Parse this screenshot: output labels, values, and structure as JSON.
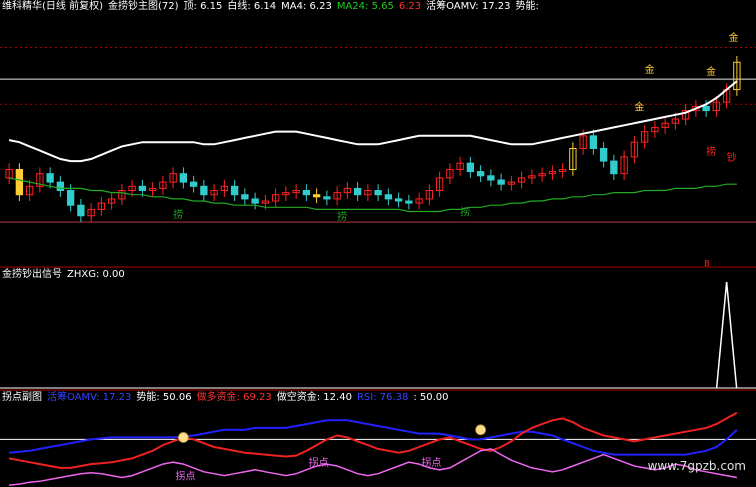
{
  "colors": {
    "bg": "#000000",
    "white_line": "#ffffff",
    "green_line": "#22aa22",
    "up": "#ff2222",
    "down": "#33cccc",
    "gold": "#ffcc33",
    "divider": "#aa0000",
    "blue": "#2222ff",
    "red": "#ee2222",
    "purple": "#ee66ee"
  },
  "main_header": {
    "stock_name": "维科精华(日线 前复权)",
    "indicator": "金捞钞主图(72)",
    "top_label": "顶: 6.15",
    "white_label": "白线: 6.14",
    "ma4_label": "MA4: 6.23",
    "ma24_label": "MA24: 5.65",
    "extra_value": "6.23",
    "oamv_label": "活筹OAMV: 17.23",
    "shineng_label": "势能:"
  },
  "signal_header": {
    "title": "金捞钞出信号",
    "value_label": "ZHXG: 0.00"
  },
  "sub_header": {
    "title": "拐点副图",
    "oamv": "活筹OAMV: 17.23",
    "shineng": "势能: 50.06",
    "duo": "做多资金: 69.23",
    "kong": "做空资金: 12.40",
    "rsi": "RSI: 76.38",
    "ref": ": 50.00"
  },
  "markers": {
    "jin": "金",
    "lao": "捞",
    "chao": "钞",
    "guaidian": "拐点",
    "bottom_tag": "B"
  },
  "watermark": "www.7gpzb.com",
  "chart_data": {
    "type": "line",
    "title": "",
    "n_bars": 72,
    "main_levels": {
      "top": 6.15,
      "ma4": 6.23,
      "ma24": 5.65,
      "white": 6.14
    },
    "white_line": [
      5.86,
      5.85,
      5.83,
      5.81,
      5.79,
      5.77,
      5.76,
      5.76,
      5.77,
      5.79,
      5.81,
      5.83,
      5.84,
      5.85,
      5.85,
      5.85,
      5.85,
      5.85,
      5.85,
      5.84,
      5.84,
      5.85,
      5.86,
      5.87,
      5.88,
      5.89,
      5.9,
      5.9,
      5.9,
      5.89,
      5.88,
      5.87,
      5.86,
      5.85,
      5.84,
      5.84,
      5.84,
      5.85,
      5.86,
      5.87,
      5.88,
      5.88,
      5.88,
      5.88,
      5.88,
      5.88,
      5.87,
      5.86,
      5.85,
      5.84,
      5.84,
      5.84,
      5.85,
      5.86,
      5.87,
      5.88,
      5.89,
      5.9,
      5.91,
      5.92,
      5.93,
      5.94,
      5.95,
      5.96,
      5.97,
      5.98,
      5.99,
      6.01,
      6.03,
      6.06,
      6.1,
      6.14
    ],
    "green_line": [
      5.68,
      5.67,
      5.66,
      5.65,
      5.64,
      5.63,
      5.63,
      5.63,
      5.62,
      5.62,
      5.61,
      5.61,
      5.6,
      5.6,
      5.59,
      5.59,
      5.58,
      5.58,
      5.57,
      5.57,
      5.56,
      5.56,
      5.55,
      5.55,
      5.55,
      5.54,
      5.54,
      5.54,
      5.54,
      5.54,
      5.53,
      5.53,
      5.53,
      5.53,
      5.53,
      5.53,
      5.53,
      5.53,
      5.53,
      5.52,
      5.52,
      5.52,
      5.52,
      5.53,
      5.53,
      5.54,
      5.54,
      5.55,
      5.55,
      5.56,
      5.56,
      5.57,
      5.57,
      5.58,
      5.58,
      5.59,
      5.59,
      5.6,
      5.6,
      5.61,
      5.61,
      5.61,
      5.62,
      5.62,
      5.62,
      5.63,
      5.63,
      5.63,
      5.64,
      5.64,
      5.65,
      5.65
    ],
    "closes": [
      5.72,
      5.6,
      5.64,
      5.7,
      5.66,
      5.62,
      5.55,
      5.5,
      5.53,
      5.56,
      5.58,
      5.62,
      5.64,
      5.62,
      5.63,
      5.66,
      5.7,
      5.66,
      5.64,
      5.6,
      5.62,
      5.64,
      5.6,
      5.58,
      5.56,
      5.57,
      5.6,
      5.61,
      5.62,
      5.6,
      5.59,
      5.58,
      5.61,
      5.63,
      5.6,
      5.62,
      5.6,
      5.58,
      5.57,
      5.56,
      5.58,
      5.62,
      5.68,
      5.72,
      5.75,
      5.71,
      5.69,
      5.67,
      5.65,
      5.66,
      5.68,
      5.69,
      5.7,
      5.71,
      5.72,
      5.82,
      5.88,
      5.82,
      5.76,
      5.7,
      5.78,
      5.85,
      5.9,
      5.92,
      5.94,
      5.96,
      6.0,
      6.02,
      6.0,
      6.04,
      6.1,
      6.23
    ],
    "zhxg_spike": {
      "bar": 70,
      "value": 1.0
    },
    "sub_levels": {
      "oamv": 17.23,
      "shineng": 50.06,
      "duo": 69.23,
      "kong": 12.4,
      "rsi": 76.38,
      "ref": 50.0
    },
    "red_line": [
      30,
      28,
      26,
      24,
      22,
      20,
      20,
      22,
      24,
      25,
      26,
      28,
      30,
      34,
      38,
      44,
      48,
      52,
      50,
      46,
      42,
      40,
      38,
      36,
      35,
      34,
      33,
      32,
      33,
      38,
      44,
      50,
      54,
      52,
      48,
      44,
      40,
      38,
      36,
      38,
      42,
      46,
      50,
      52,
      48,
      44,
      40,
      38,
      42,
      48,
      56,
      62,
      66,
      70,
      72,
      68,
      62,
      58,
      54,
      52,
      50,
      48,
      50,
      52,
      54,
      56,
      58,
      60,
      62,
      66,
      72,
      78
    ],
    "blue_line": [
      36,
      37,
      38,
      40,
      42,
      44,
      46,
      48,
      50,
      51,
      52,
      52,
      52,
      52,
      52,
      52,
      52,
      53,
      54,
      56,
      58,
      60,
      60,
      60,
      62,
      62,
      62,
      62,
      64,
      66,
      68,
      70,
      70,
      70,
      68,
      66,
      64,
      62,
      60,
      58,
      56,
      56,
      56,
      54,
      52,
      50,
      50,
      52,
      54,
      56,
      58,
      58,
      56,
      54,
      50,
      46,
      42,
      38,
      36,
      34,
      34,
      34,
      34,
      34,
      34,
      34,
      34,
      36,
      38,
      42,
      50,
      60
    ],
    "purple_line": [
      2,
      3,
      5,
      6,
      8,
      10,
      12,
      14,
      15,
      14,
      12,
      10,
      12,
      16,
      20,
      24,
      26,
      24,
      20,
      16,
      14,
      12,
      14,
      16,
      18,
      16,
      14,
      12,
      14,
      18,
      22,
      24,
      22,
      18,
      14,
      12,
      14,
      18,
      22,
      26,
      24,
      20,
      18,
      20,
      26,
      32,
      38,
      40,
      34,
      28,
      24,
      20,
      18,
      16,
      18,
      22,
      26,
      30,
      34,
      30,
      26,
      22,
      20,
      18,
      20,
      24,
      22,
      18,
      16,
      14,
      12,
      10
    ]
  }
}
